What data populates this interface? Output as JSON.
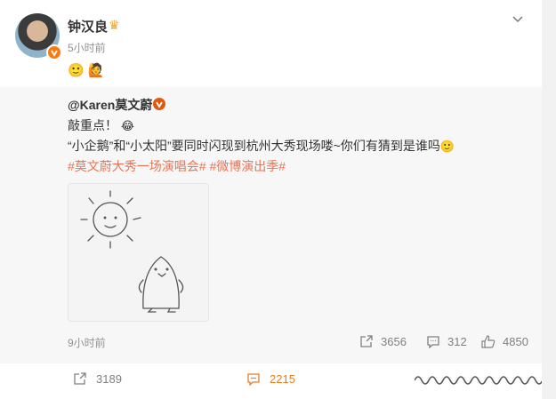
{
  "post": {
    "author": "钟汉良",
    "time": "5小时前",
    "emoji_1": "🙂",
    "emoji_2": "🙋"
  },
  "repost": {
    "author": "@Karen莫文蔚",
    "line1": "敲重点！",
    "line1_emoji": "😂",
    "line2": "“小企鹅”和“小太阳”要同时闪现到杭州大秀现场喽~你们有猜到是谁吗",
    "line2_emoji": "🙂",
    "topic1": "#莫文蔚大秀一场演唱会#",
    "topic2": "#微博演出季#",
    "time": "9小时前",
    "forward_count": "3656",
    "comment_count": "312",
    "like_count": "4850"
  },
  "footer": {
    "forward_count": "3189",
    "comment_count": "2215"
  },
  "colors": {
    "topic": "#eb7350",
    "badge": "#f77b0f",
    "comment_active": "#e67e22"
  }
}
